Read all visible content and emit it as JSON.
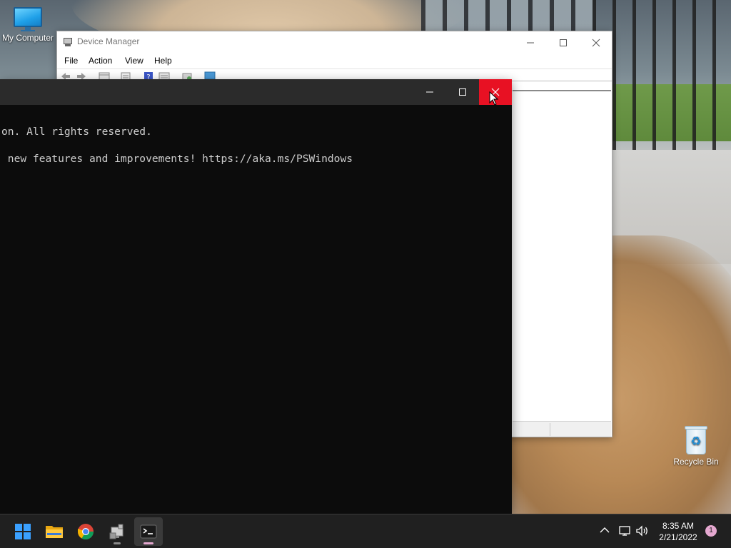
{
  "desktop": {
    "icons": [
      {
        "label": "My Computer",
        "icon": "monitor-icon"
      },
      {
        "label": "Recycle Bin",
        "icon": "recycle-bin-icon"
      }
    ]
  },
  "device_manager": {
    "title": "Device Manager",
    "menu": [
      "File",
      "Action",
      "View",
      "Help"
    ],
    "toolbar_icons": [
      "back-arrow-icon",
      "forward-arrow-icon",
      "show-hide-tree-icon",
      "properties-icon",
      "help-icon",
      "view-icon",
      "scan-hardware-icon",
      "monitor-icon"
    ]
  },
  "terminal": {
    "lines": [
      "on. All rights reserved.",
      " new features and improvements! https://aka.ms/PSWindows"
    ],
    "controls": {
      "minimize": "─",
      "maximize": "☐",
      "close": "✕"
    }
  },
  "taskbar": {
    "apps": [
      {
        "name": "Start",
        "icon": "windows-start-icon"
      },
      {
        "name": "File Explorer",
        "icon": "folder-icon"
      },
      {
        "name": "Google Chrome",
        "icon": "chrome-icon"
      },
      {
        "name": "Device Manager",
        "icon": "device-manager-icon"
      },
      {
        "name": "Terminal",
        "icon": "terminal-icon"
      }
    ],
    "tray": {
      "chevron": "^",
      "time": "8:35 AM",
      "date": "2/21/2022",
      "notifications_count": "1"
    }
  },
  "colors": {
    "close_hover": "#e81123",
    "terminal_bg": "#0c0c0c",
    "taskbar_bg": "#202020",
    "accent_pink": "#e5a8d0"
  }
}
